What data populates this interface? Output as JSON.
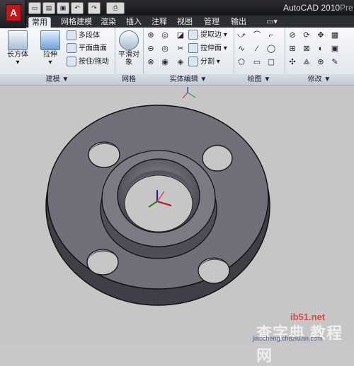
{
  "app": {
    "logo_letter": "A",
    "title": "AutoCAD 2010",
    "title_suffix": "Pre"
  },
  "quick_access": [
    "new-icon",
    "open-icon",
    "save-icon",
    "undo-icon",
    "redo-icon",
    "plot-icon"
  ],
  "tabs": [
    {
      "label": "常用",
      "active": true
    },
    {
      "label": "网格建模"
    },
    {
      "label": "渲染"
    },
    {
      "label": "插入"
    },
    {
      "label": "注释"
    },
    {
      "label": "视图"
    },
    {
      "label": "管理"
    },
    {
      "label": "输出"
    }
  ],
  "panels": {
    "modeling": {
      "title": "建模 ▼",
      "box": "长方体",
      "extrude": "拉伸",
      "polysolid": "多段体",
      "planar_surface": "平面曲面",
      "presspull": "按住/拖动"
    },
    "mesh": {
      "title": "网格",
      "smooth": "平滑对象"
    },
    "solid_editing": {
      "title": "实体编辑 ▼",
      "extract_edges": "提取边",
      "extrude_face": "拉伸面",
      "separate": "分割"
    },
    "draw": {
      "title": "绘图 ▼"
    },
    "modify": {
      "title": "修改 ▼"
    }
  },
  "watermark": {
    "site": "ib51.net",
    "text": "查字典 教程网",
    "url": "jiaocheng.chazidian.com"
  },
  "colors": {
    "accent": "#c8141a",
    "ribbon": "#e4e9ef",
    "viewport": "#c6c6c6",
    "part": "#6d6e77"
  }
}
